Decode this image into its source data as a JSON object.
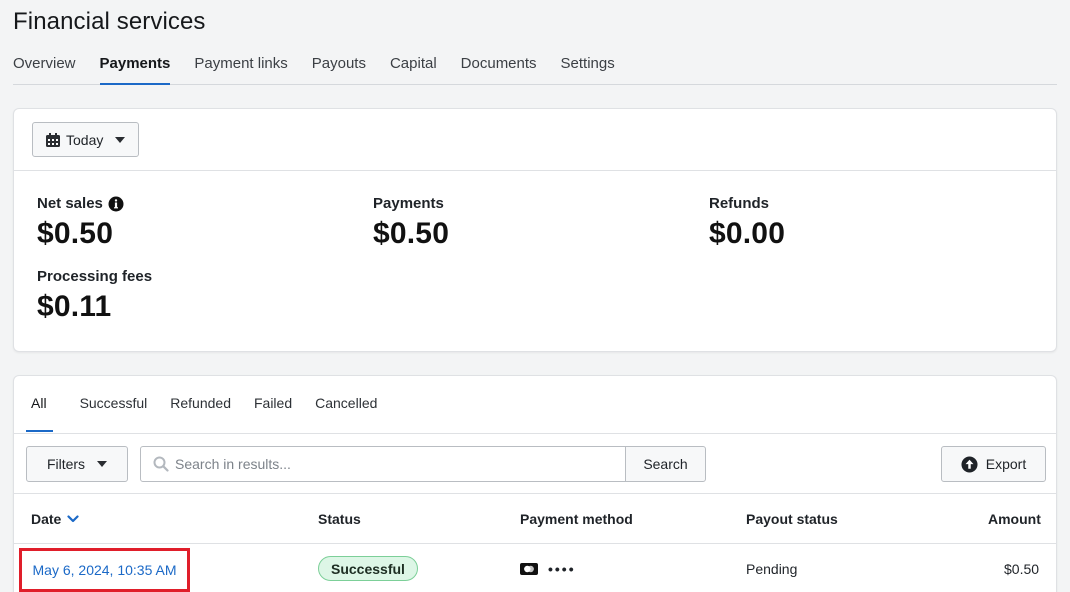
{
  "page": {
    "title": "Financial services"
  },
  "nav": {
    "tabs": [
      {
        "label": "Overview",
        "active": false
      },
      {
        "label": "Payments",
        "active": true
      },
      {
        "label": "Payment links",
        "active": false
      },
      {
        "label": "Payouts",
        "active": false
      },
      {
        "label": "Capital",
        "active": false
      },
      {
        "label": "Documents",
        "active": false
      },
      {
        "label": "Settings",
        "active": false
      }
    ]
  },
  "summary": {
    "date_range": "Today",
    "metrics": {
      "net_sales": {
        "label": "Net sales",
        "value": "$0.50"
      },
      "payments": {
        "label": "Payments",
        "value": "$0.50"
      },
      "refunds": {
        "label": "Refunds",
        "value": "$0.00"
      },
      "processing_fees": {
        "label": "Processing fees",
        "value": "$0.11"
      }
    }
  },
  "transactions": {
    "tabs": [
      {
        "label": "All",
        "active": true
      },
      {
        "label": "Successful",
        "active": false
      },
      {
        "label": "Refunded",
        "active": false
      },
      {
        "label": "Failed",
        "active": false
      },
      {
        "label": "Cancelled",
        "active": false
      }
    ],
    "toolbar": {
      "filters_label": "Filters",
      "search_placeholder": "Search in results...",
      "search_label": "Search",
      "export_label": "Export"
    },
    "columns": {
      "date": "Date",
      "status": "Status",
      "payment_method": "Payment method",
      "payout_status": "Payout status",
      "amount": "Amount"
    },
    "rows": [
      {
        "date": "May 6, 2024, 10:35 AM",
        "status": "Successful",
        "payment_method_mask": "••••",
        "payout_status": "Pending",
        "amount": "$0.50"
      }
    ]
  },
  "colors": {
    "accent": "#1b69c7",
    "success_bg": "#ddf6e6",
    "success_border": "#7ccf98",
    "highlight": "#e01e2a"
  },
  "icons": {
    "date_button": "calendar-icon",
    "net_sales_info": "info-icon",
    "search": "search-icon",
    "export": "upload-arrow-icon",
    "sort": "chevron-down-icon",
    "payment_method": "card-icon"
  }
}
